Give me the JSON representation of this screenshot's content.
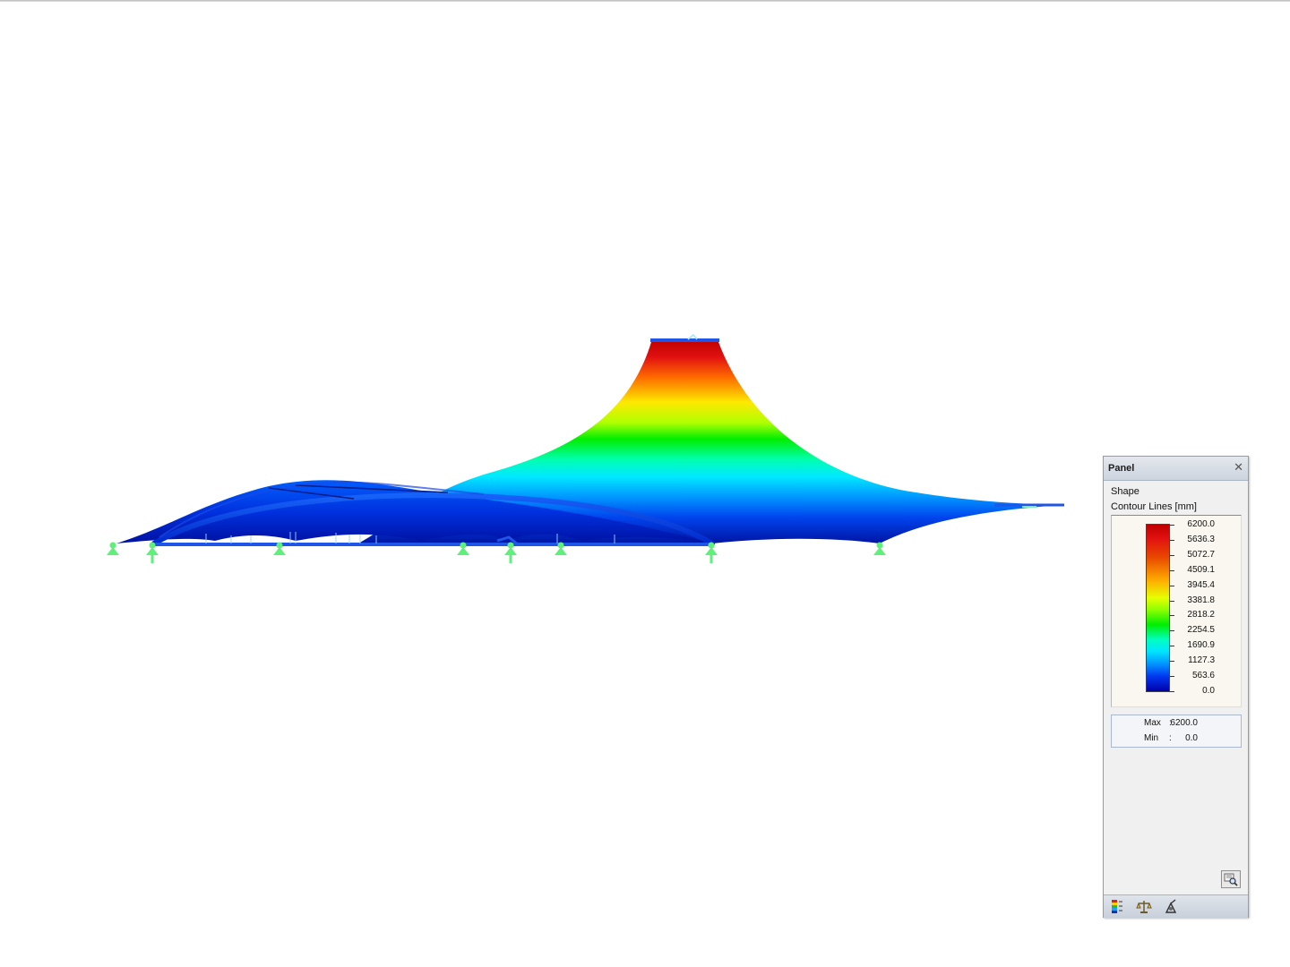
{
  "panel": {
    "title": "Panel",
    "close_glyph": "✕",
    "shape_label": "Shape",
    "contour_label": "Contour Lines [mm]",
    "legend_values": [
      "6200.0",
      "5636.3",
      "5072.7",
      "4509.1",
      "3945.4",
      "3381.8",
      "2818.2",
      "2254.5",
      "1690.9",
      "1127.3",
      "563.6",
      "0.0"
    ],
    "max_label": "Max",
    "max_value": "6200.0",
    "min_label": "Min",
    "min_value": "0.0",
    "colon": ":",
    "toolbar_icons": [
      "color-scale-icon",
      "balance-scale-icon",
      "view-settings-icon"
    ],
    "panel_button_icon": "zoom-legend-icon"
  },
  "model": {
    "view": "membrane-structure-elevation",
    "support_color": "#5ef07a",
    "member_color": "#1f55e8",
    "contour_max_color": "#c00000",
    "contour_min_color": "#0000a8"
  }
}
